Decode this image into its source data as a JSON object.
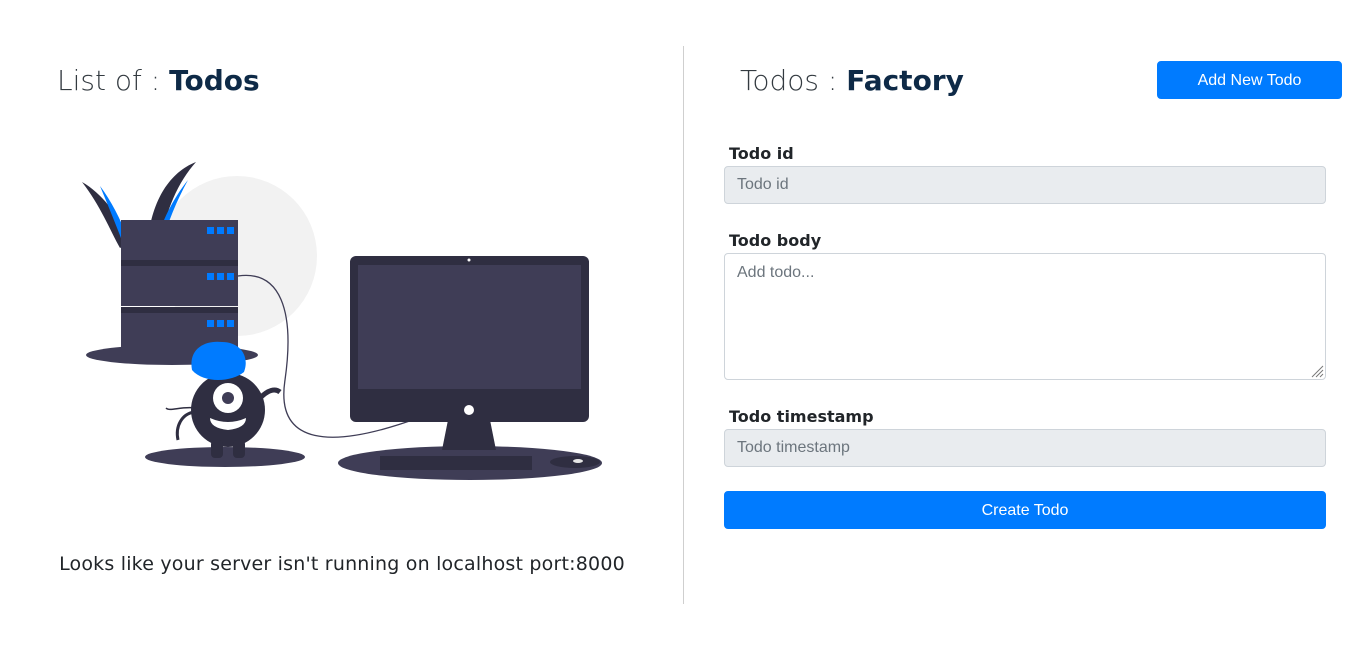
{
  "left": {
    "heading_light": "List of : ",
    "heading_bold": "Todos",
    "server_message": "Looks like your server isn't running on localhost port:8000"
  },
  "right": {
    "heading_light": "Todos : ",
    "heading_bold": "Factory",
    "add_button_label": "Add New Todo",
    "form": {
      "todo_id_label": "Todo id",
      "todo_id_placeholder": "Todo id",
      "todo_body_label": "Todo body",
      "todo_body_placeholder": "Add todo...",
      "todo_timestamp_label": "Todo timestamp",
      "todo_timestamp_placeholder": "Todo timestamp",
      "create_button_label": "Create Todo"
    }
  },
  "colors": {
    "primary": "#007bff",
    "heading_dark": "#0e2a47",
    "illustration_dark": "#3f3d56",
    "illustration_darker": "#2f2e41",
    "illustration_light": "#f2f2f2"
  }
}
